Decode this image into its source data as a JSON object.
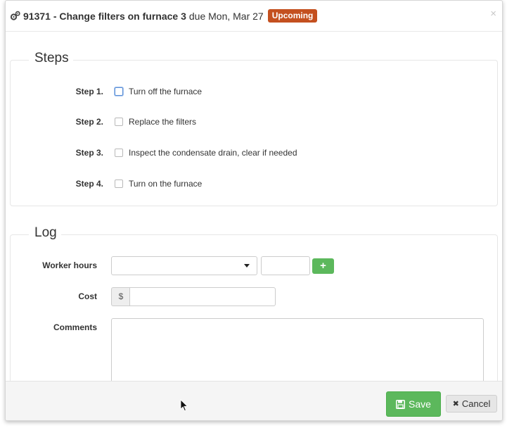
{
  "header": {
    "task_number": "91371",
    "separator": " - ",
    "title": "Change filters on furnace 3",
    "due": "due Mon, Mar 27",
    "status_badge": "Upcoming",
    "close": "×",
    "icon": "gears-icon"
  },
  "steps": {
    "legend": "Steps",
    "items": [
      {
        "label": "Step 1.",
        "text": "Turn off the furnace",
        "checked": false
      },
      {
        "label": "Step 2.",
        "text": "Replace the filters",
        "checked": false
      },
      {
        "label": "Step 3.",
        "text": "Inspect the condensate drain, clear if needed",
        "checked": false
      },
      {
        "label": "Step 4.",
        "text": "Turn on the furnace",
        "checked": false
      }
    ]
  },
  "log": {
    "legend": "Log",
    "worker_hours_label": "Worker hours",
    "worker_select_value": "",
    "hours_value": "",
    "add_label": "+",
    "cost_label": "Cost",
    "cost_prefix": "$",
    "cost_value": "",
    "comments_label": "Comments",
    "comments_value": ""
  },
  "footer": {
    "save_label": "Save",
    "cancel_label": "Cancel",
    "cancel_icon": "✖"
  },
  "colors": {
    "badge": "#c4501f",
    "success": "#5cb85c",
    "focus": "#5b8fd6"
  }
}
